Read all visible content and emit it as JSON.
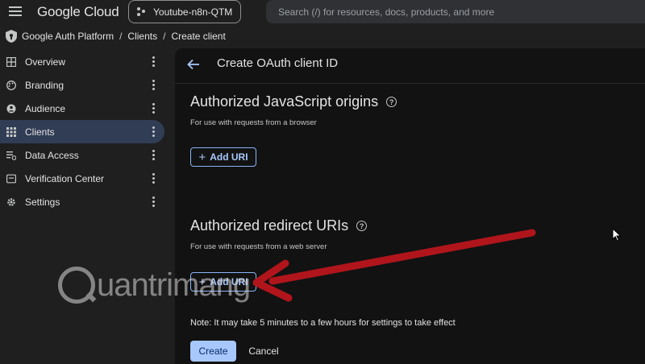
{
  "topbar": {
    "logo": "Google Cloud",
    "project": "Youtube-n8n-QTM",
    "search_placeholder": "Search (/) for resources, docs, products, and more"
  },
  "breadcrumb": {
    "items": [
      "Google Auth Platform",
      "Clients",
      "Create client"
    ],
    "separator": "/"
  },
  "sidebar": {
    "items": [
      {
        "label": "Overview",
        "icon": "dashboard-icon"
      },
      {
        "label": "Branding",
        "icon": "palette-icon"
      },
      {
        "label": "Audience",
        "icon": "person-icon"
      },
      {
        "label": "Clients",
        "icon": "apps-grid-icon",
        "active": true
      },
      {
        "label": "Data Access",
        "icon": "data-access-icon"
      },
      {
        "label": "Verification Center",
        "icon": "verification-icon"
      },
      {
        "label": "Settings",
        "icon": "gear-icon"
      }
    ]
  },
  "main": {
    "title": "Create OAuth client ID",
    "origins": {
      "title": "Authorized JavaScript origins",
      "description": "For use with requests from a browser",
      "add_label": "Add URI"
    },
    "redirects": {
      "title": "Authorized redirect URIs",
      "description": "For use with requests from a web server",
      "add_label": "Add URI"
    },
    "note": "Note: It may take 5 minutes to a few hours for settings to take effect",
    "create_label": "Create",
    "cancel_label": "Cancel"
  },
  "overlay": {
    "watermark": "uantrimang"
  },
  "colors": {
    "accent": "#a8c7fa",
    "active_nav": "#303d55",
    "annotation_arrow": "#b0151c"
  }
}
